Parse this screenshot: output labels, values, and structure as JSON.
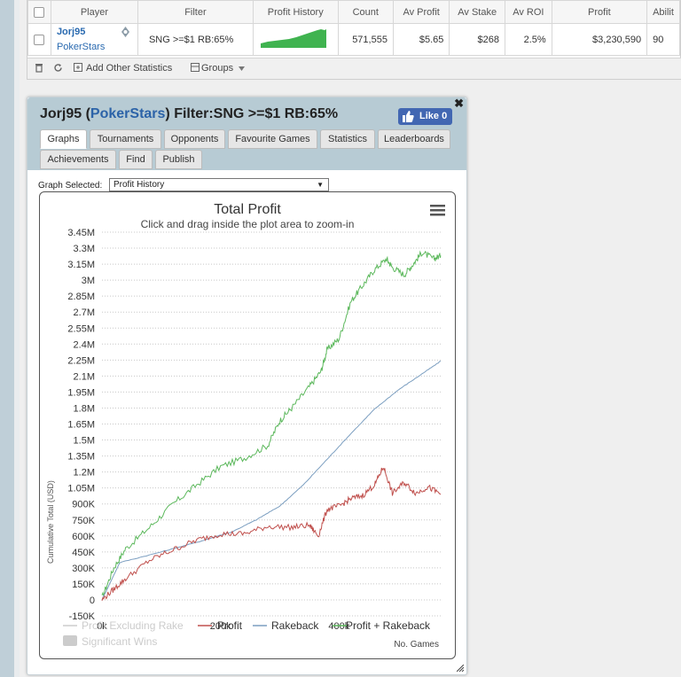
{
  "stats_table": {
    "headers": [
      "Player",
      "Filter",
      "Profit History",
      "Count",
      "Av Profit",
      "Av Stake",
      "Av ROI",
      "Profit",
      "Abilit"
    ],
    "row": {
      "player_name": "Jorj95",
      "player_site": "PokerStars",
      "filter": "SNG >=$1 RB:65%",
      "count": "571,555",
      "av_profit": "$5.65",
      "av_stake": "$268",
      "av_roi": "2.5%",
      "profit": "$3,230,590",
      "ability": "90"
    }
  },
  "toolbar": {
    "add_stats_label": "Add Other Statistics",
    "groups_label": "Groups"
  },
  "window": {
    "title_name": "Jorj95",
    "title_site": "PokerStars",
    "title_filter": "Filter:SNG >=$1 RB:65%",
    "like_label": "Like 0",
    "tabs": [
      "Graphs",
      "Tournaments",
      "Opponents",
      "Favourite Games",
      "Statistics",
      "Leaderboards",
      "Achievements",
      "Find",
      "Publish"
    ],
    "active_tab": "Graphs",
    "graph_selected_label": "Graph Selected:",
    "graph_selected_value": "Profit History"
  },
  "chart_data": {
    "type": "line",
    "title": "Total Profit",
    "subtitle": "Click and drag inside the plot area to zoom-in",
    "ylabel": "Cumulative Total (USD)",
    "xlabel": "No. Games",
    "ylim": [
      -150000,
      3450000
    ],
    "xlim": [
      0,
      571555
    ],
    "y_ticks": [
      "-150K",
      "0",
      "150K",
      "300K",
      "450K",
      "600K",
      "750K",
      "900K",
      "1.05M",
      "1.2M",
      "1.35M",
      "1.5M",
      "1.65M",
      "1.8M",
      "1.95M",
      "2.1M",
      "2.25M",
      "2.4M",
      "2.55M",
      "2.7M",
      "2.85M",
      "3M",
      "3.15M",
      "3.3M",
      "3.45M"
    ],
    "x_ticks": [
      "0k",
      "200k",
      "400k"
    ],
    "legend": [
      "Profit Excluding Rake",
      "Profit",
      "Rakeback",
      "Profit + Rakeback",
      "Significant Wins"
    ],
    "series": [
      {
        "name": "Profit + Rakeback",
        "color": "#5cb85c",
        "points": [
          [
            0,
            20000
          ],
          [
            20000,
            300000
          ],
          [
            40000,
            480000
          ],
          [
            80000,
            680000
          ],
          [
            120000,
            900000
          ],
          [
            160000,
            1080000
          ],
          [
            200000,
            1250000
          ],
          [
            240000,
            1330000
          ],
          [
            280000,
            1450000
          ],
          [
            300000,
            1680000
          ],
          [
            320000,
            1800000
          ],
          [
            350000,
            2000000
          ],
          [
            370000,
            2150000
          ],
          [
            380000,
            2350000
          ],
          [
            400000,
            2450000
          ],
          [
            420000,
            2800000
          ],
          [
            440000,
            2950000
          ],
          [
            460000,
            3100000
          ],
          [
            480000,
            3200000
          ],
          [
            490000,
            3120000
          ],
          [
            510000,
            3050000
          ],
          [
            525000,
            3150000
          ],
          [
            540000,
            3260000
          ],
          [
            560000,
            3200000
          ],
          [
            571555,
            3230590
          ]
        ]
      },
      {
        "name": "Rakeback",
        "color": "#7b9ec0",
        "points": [
          [
            0,
            0
          ],
          [
            30000,
            350000
          ],
          [
            100000,
            450000
          ],
          [
            160000,
            540000
          ],
          [
            220000,
            640000
          ],
          [
            260000,
            750000
          ],
          [
            300000,
            880000
          ],
          [
            340000,
            1080000
          ],
          [
            380000,
            1320000
          ],
          [
            420000,
            1560000
          ],
          [
            460000,
            1790000
          ],
          [
            500000,
            1970000
          ],
          [
            540000,
            2120000
          ],
          [
            571555,
            2240000
          ]
        ]
      },
      {
        "name": "Profit",
        "color": "#c0504d",
        "points": [
          [
            0,
            0
          ],
          [
            20000,
            100000
          ],
          [
            40000,
            200000
          ],
          [
            80000,
            370000
          ],
          [
            120000,
            470000
          ],
          [
            160000,
            560000
          ],
          [
            200000,
            620000
          ],
          [
            240000,
            620000
          ],
          [
            280000,
            690000
          ],
          [
            320000,
            680000
          ],
          [
            350000,
            700000
          ],
          [
            365000,
            600000
          ],
          [
            380000,
            850000
          ],
          [
            400000,
            880000
          ],
          [
            420000,
            950000
          ],
          [
            440000,
            980000
          ],
          [
            460000,
            1080000
          ],
          [
            475000,
            1250000
          ],
          [
            490000,
            1000000
          ],
          [
            510000,
            1100000
          ],
          [
            530000,
            1000000
          ],
          [
            550000,
            1060000
          ],
          [
            571555,
            990000
          ]
        ]
      }
    ]
  }
}
